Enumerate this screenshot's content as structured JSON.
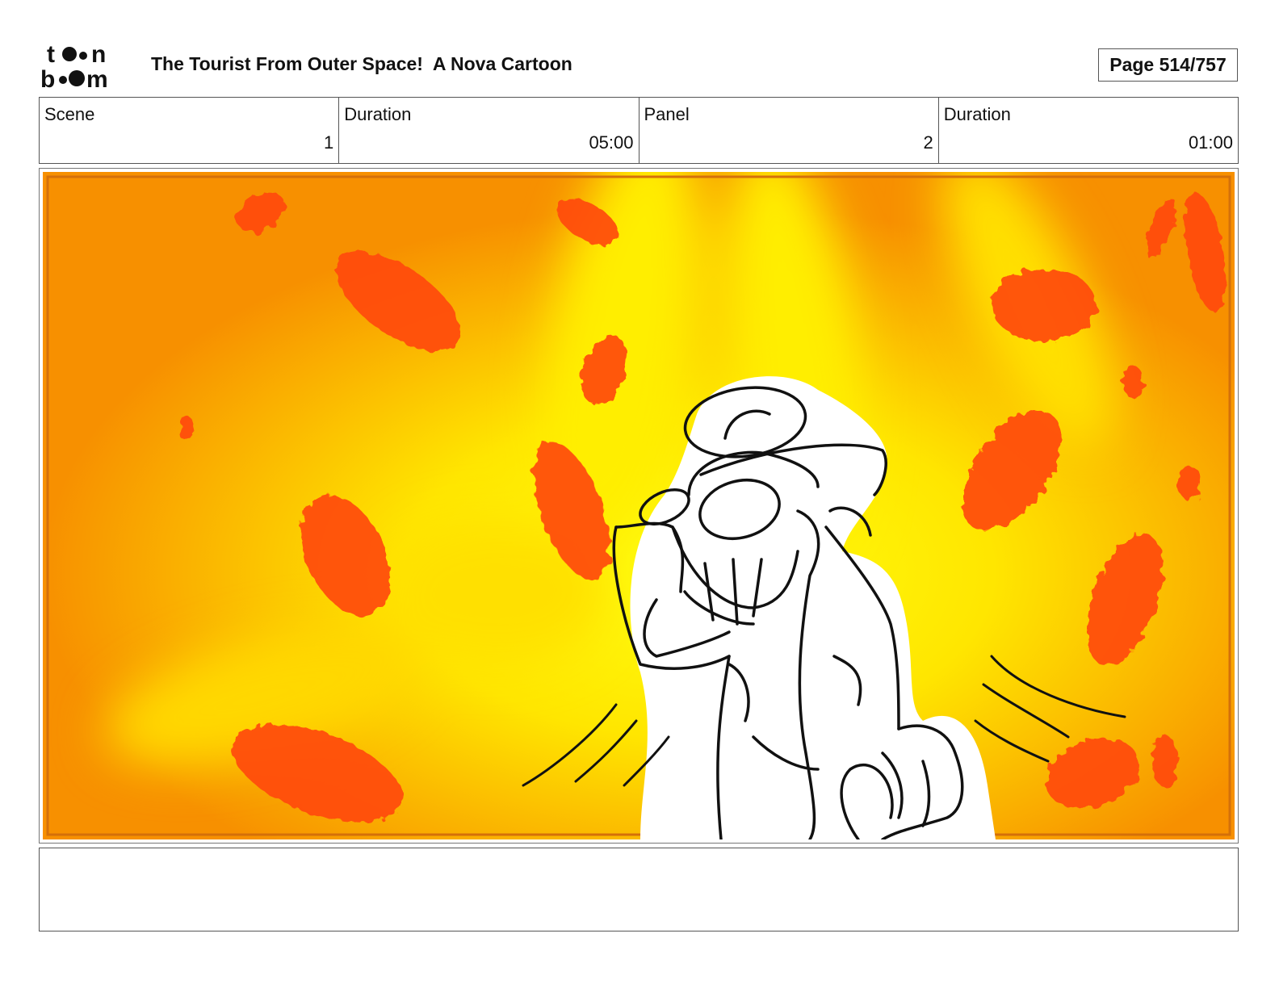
{
  "header": {
    "logo_text": "toon boom",
    "title": "The Tourist From Outer Space!  A Nova Cartoon",
    "page": "Page 514/757"
  },
  "info": {
    "scene_label": "Scene",
    "scene_value": "1",
    "scene_duration_label": "Duration",
    "scene_duration_value": "05:00",
    "panel_label": "Panel",
    "panel_value": "2",
    "panel_duration_label": "Duration",
    "panel_duration_value": "01:00"
  },
  "colors": {
    "background_orange": "#f79000",
    "background_yellow": "#ffee00",
    "blob_red": "#ff4a10",
    "ink": "#111111"
  },
  "notes": ""
}
